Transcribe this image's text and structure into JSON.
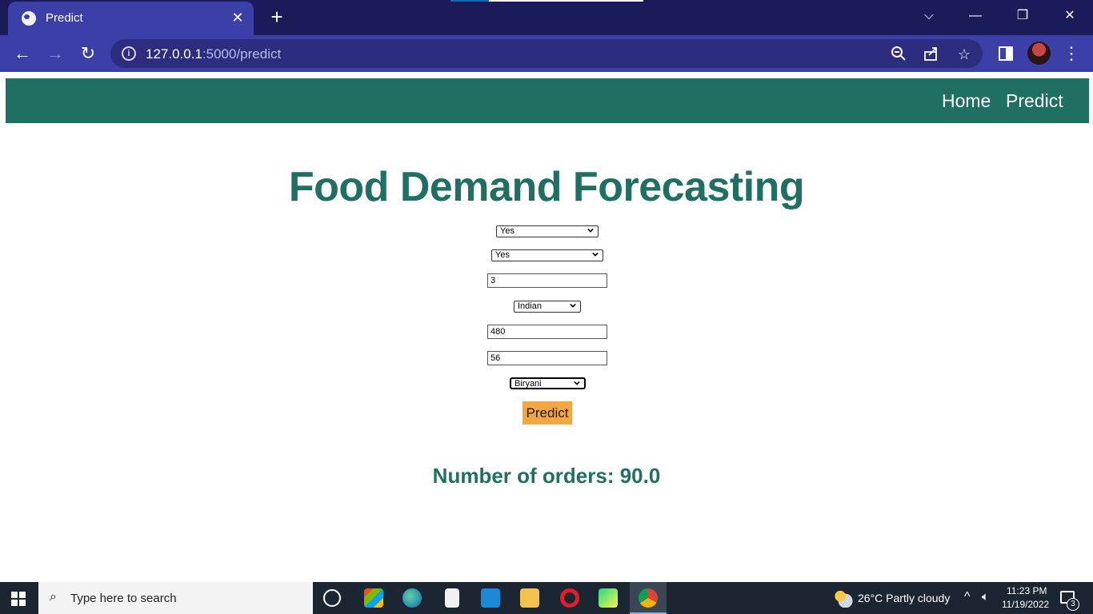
{
  "browser": {
    "tab_title": "Predict",
    "tab_close": "✕",
    "new_tab": "+",
    "url_host": "127.0.0.1",
    "url_path": ":5000/predict",
    "window_controls": {
      "tab_search": "⌵",
      "minimize": "—",
      "restore": "❐",
      "close": "✕"
    }
  },
  "site_nav": {
    "home": "Home",
    "predict": "Predict"
  },
  "page": {
    "title": "Food Demand Forecasting",
    "form": {
      "emailer_for_promotion": "Yes",
      "homepage_featured": "Yes",
      "op_area": "3",
      "cuisine": "Indian",
      "city_code": "480",
      "region_code": "56",
      "category": "Biryani"
    },
    "submit_label": "Predict",
    "result": "Number of orders: 90.0"
  },
  "taskbar": {
    "search_placeholder": "Type here to search",
    "weather": "26°C  Partly cloudy",
    "time": "11:23 PM",
    "date": "11/19/2022",
    "notification_count": "3"
  },
  "colors": {
    "brand": "#1f7062",
    "button": "#f4a640",
    "browser_frame": "#3d3fa8"
  }
}
